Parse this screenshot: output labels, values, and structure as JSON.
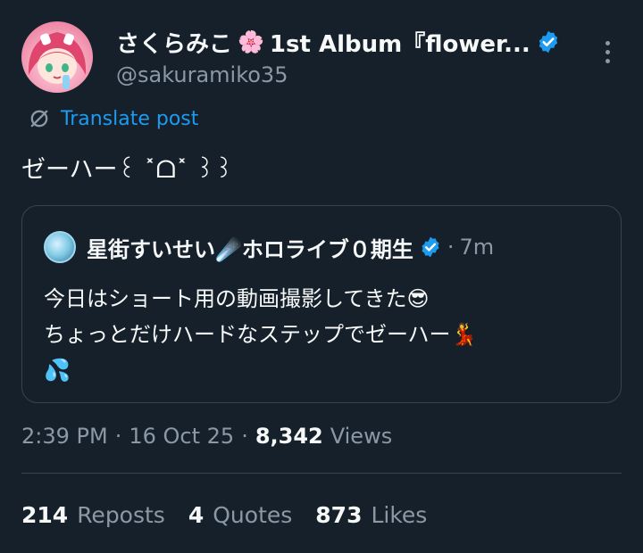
{
  "author": {
    "display_name": "さくらみこ",
    "display_name_emoji": "🌸",
    "display_name_suffix": "1st Album『flower...",
    "handle": "@sakuramiko35",
    "verified": true
  },
  "translate_label": "Translate post",
  "tweet_text": "ゼーハー꒰ ˟ᗝ˟ ꒱꒱",
  "quote": {
    "name": "星街すいせい☄️ホロライブ０期生",
    "separator": "·",
    "time": "7m",
    "lines": [
      "今日はショート用の動画撮影してきた😎",
      "ちょっとだけハードなステップでゼーハー💃",
      "💦"
    ]
  },
  "meta": {
    "time": "2:39 PM",
    "date": "16 Oct 25",
    "separator": "·",
    "views_count": "8,342",
    "views_label": "Views"
  },
  "stats": {
    "reposts": {
      "count": "214",
      "label": "Reposts"
    },
    "quotes": {
      "count": "4",
      "label": "Quotes"
    },
    "likes": {
      "count": "873",
      "label": "Likes"
    }
  },
  "colors": {
    "background": "#15202b",
    "accent": "#1d9bf0",
    "muted": "#8b98a5",
    "border": "#38444d"
  }
}
